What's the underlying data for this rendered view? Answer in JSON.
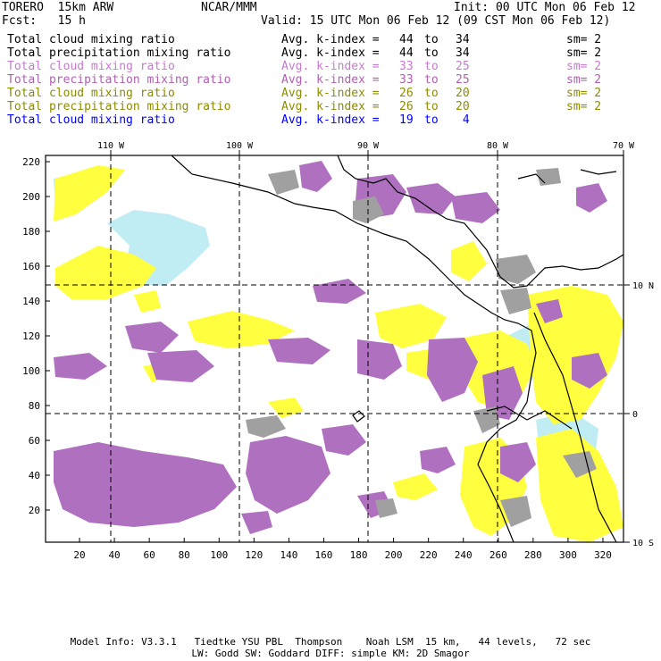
{
  "header": {
    "model": "TORERO  15km ARW",
    "center": "NCAR/MMM",
    "init": "Init: 00 UTC Mon 06 Feb 12",
    "fcst": "Fcst:   15 h",
    "valid": "Valid: 15 UTC Mon 06 Feb 12 (09 CST Mon 06 Feb 12)"
  },
  "legend": [
    {
      "field": "Total cloud mixing ratio",
      "index": "Avg. k-index = ",
      "from": "44",
      "to": "34",
      "sm": "sm= 2",
      "color": "#000000"
    },
    {
      "field": "Total precipitation mixing ratio",
      "index": "Avg. k-index = ",
      "from": "44",
      "to": "34",
      "sm": "sm= 2",
      "color": "#000000"
    },
    {
      "field": "Total cloud mixing ratio",
      "index": "Avg. k-index = ",
      "from": "33",
      "to": "25",
      "sm": "sm= 2",
      "color": "#c77ad0"
    },
    {
      "field": "Total precipitation mixing ratio",
      "index": "Avg. k-index = ",
      "from": "33",
      "to": "25",
      "sm": "sm= 2",
      "color": "#b060b0"
    },
    {
      "field": "Total cloud mixing ratio",
      "index": "Avg. k-index = ",
      "from": "26",
      "to": "20",
      "sm": "sm= 2",
      "color": "#8c8c00"
    },
    {
      "field": "Total precipitation mixing ratio",
      "index": "Avg. k-index = ",
      "from": "26",
      "to": "20",
      "sm": "sm= 2",
      "color": "#8c8c00"
    },
    {
      "field": "Total cloud mixing ratio",
      "index": "Avg. k-index = ",
      "from": "19",
      "to": " 4",
      "sm": "",
      "color": "#0000ff"
    }
  ],
  "map": {
    "top_lon_labels": [
      "110 W",
      "100 W",
      "90 W",
      "80 W",
      "70 W"
    ],
    "right_lat_labels": [
      "10 N",
      "0",
      "10 S"
    ],
    "y_ticks": [
      "220",
      "200",
      "180",
      "160",
      "140",
      "120",
      "100",
      "80",
      "60",
      "40",
      "20"
    ],
    "x_ticks": [
      "20",
      "40",
      "60",
      "80",
      "100",
      "120",
      "140",
      "160",
      "180",
      "200",
      "220",
      "240",
      "260",
      "280",
      "300",
      "320"
    ],
    "colors": {
      "gray_cloud": "#a0a0a0",
      "purple_precip": "#b070c0",
      "yellow_cloud": "#ffff40",
      "light_blue": "#c0ecf4",
      "coastline": "#000000"
    }
  },
  "footer": {
    "line1": "Model Info: V3.3.1   Tiedtke YSU PBL  Thompson    Noah LSM  15 km,   44 levels,   72 sec",
    "line2": "LW: Godd SW: Goddard DIFF: simple KM: 2D Smagor"
  }
}
